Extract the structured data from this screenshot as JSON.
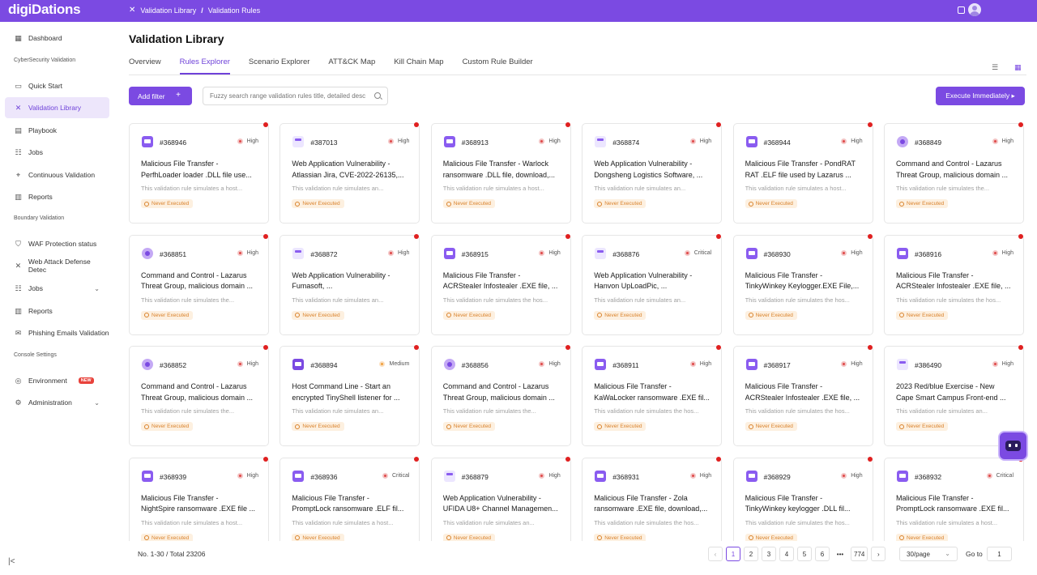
{
  "app": {
    "logo": "digiDations"
  },
  "breadcrumb": {
    "items": [
      "Validation Library",
      "Validation Rules"
    ],
    "separator": "/"
  },
  "sidebar": {
    "items": [
      {
        "label": "Dashboard",
        "icon": "grid-icon"
      },
      {
        "section": "CyberSecurity Validation"
      },
      {
        "label": "Quick Start",
        "icon": "monitor-icon"
      },
      {
        "label": "Validation Library",
        "icon": "cross-icon",
        "active": true
      },
      {
        "label": "Playbook",
        "icon": "book-icon"
      },
      {
        "label": "Jobs",
        "icon": "list-icon"
      },
      {
        "label": "Continuous Validation",
        "icon": "target-icon"
      },
      {
        "label": "Reports",
        "icon": "report-icon"
      },
      {
        "section": "Boundary Validation"
      },
      {
        "label": "WAF Protection status",
        "icon": "shield-icon"
      },
      {
        "label": "Web Attack Defense Detec",
        "icon": "cross-icon"
      },
      {
        "label": "Jobs",
        "icon": "list-icon",
        "expandable": true
      },
      {
        "label": "Reports",
        "icon": "report-icon"
      },
      {
        "label": "Phishing Emails Validation",
        "icon": "mail-icon"
      },
      {
        "section": "Console Settings"
      },
      {
        "label": "Environment",
        "icon": "env-icon",
        "badge": "NEW"
      },
      {
        "label": "Administration",
        "icon": "gear-icon",
        "expandable": true
      }
    ]
  },
  "page": {
    "title": "Validation Library"
  },
  "tabs": [
    {
      "label": "Overview"
    },
    {
      "label": "Rules Explorer",
      "active": true
    },
    {
      "label": "Scenario Explorer"
    },
    {
      "label": "ATT&CK Map"
    },
    {
      "label": "Kill Chain Map"
    },
    {
      "label": "Custom Rule Builder"
    }
  ],
  "toolbar": {
    "add_filter": "Add filter",
    "search_placeholder": "Fuzzy search range validation rules title, detailed desc",
    "execute": "Execute Immediately ▸"
  },
  "cards": [
    {
      "id": "#368946",
      "severity": "High",
      "icon": "file",
      "title1": "Malicious File Transfer -",
      "title2": "PerfhLoader loader .DLL file use...",
      "desc": "This validation rule simulates a host...",
      "status": "Never Executed"
    },
    {
      "id": "#387013",
      "severity": "High",
      "icon": "web",
      "title1": "Web Application Vulnerability -",
      "title2": "Atlassian Jira, CVE-2022-26135,...",
      "desc": "This validation rule simulates an...",
      "status": "Never Executed"
    },
    {
      "id": "#368913",
      "severity": "High",
      "icon": "file",
      "title1": "Malicious File Transfer - Warlock",
      "title2": "ransomware .DLL file, download,...",
      "desc": "This validation rule simulates a host...",
      "status": "Never Executed"
    },
    {
      "id": "#368874",
      "severity": "High",
      "icon": "web",
      "title1": "Web Application Vulnerability -",
      "title2": "Dongsheng Logistics Software, ...",
      "desc": "This validation rule simulates an...",
      "status": "Never Executed"
    },
    {
      "id": "#368944",
      "severity": "High",
      "icon": "file",
      "title1": "Malicious File Transfer - PondRAT",
      "title2": "RAT .ELF file used by Lazarus ...",
      "desc": "This validation rule simulates a host...",
      "status": "Never Executed"
    },
    {
      "id": "#368849",
      "severity": "High",
      "icon": "cc",
      "title1": "Command and Control - Lazarus",
      "title2": "Threat Group, malicious domain ...",
      "desc": "This validation rule simulates the...",
      "status": "Never Executed"
    },
    {
      "id": "#368851",
      "severity": "High",
      "icon": "cc",
      "title1": "Command and Control - Lazarus",
      "title2": "Threat Group, malicious domain ...",
      "desc": "This validation rule simulates the...",
      "status": "Never Executed"
    },
    {
      "id": "#368872",
      "severity": "High",
      "icon": "web",
      "title1": "Web Application Vulnerability -",
      "title2": "Fumasoft, ...",
      "desc": "This validation rule simulates an...",
      "status": "Never Executed"
    },
    {
      "id": "#368915",
      "severity": "High",
      "icon": "file",
      "title1": "Malicious File Transfer -",
      "title2": "ACRStealer Infostealer .EXE file, ...",
      "desc": "This validation rule simulates the hos...",
      "status": "Never Executed"
    },
    {
      "id": "#368876",
      "severity": "Critical",
      "icon": "web",
      "title1": "Web Application Vulnerability -",
      "title2": "Hanvon UpLoadPic, ...",
      "desc": "This validation rule simulates an...",
      "status": "Never Executed"
    },
    {
      "id": "#368930",
      "severity": "High",
      "icon": "file",
      "title1": "Malicious File Transfer -",
      "title2": "TinkyWinkey Keylogger.EXE File,...",
      "desc": "This validation rule simulates the hos...",
      "status": "Never Executed"
    },
    {
      "id": "#368916",
      "severity": "High",
      "icon": "file",
      "title1": "Malicious File Transfer -",
      "title2": "ACRStealer Infostealer .EXE file, ...",
      "desc": "This validation rule simulates the hos...",
      "status": "Never Executed"
    },
    {
      "id": "#368852",
      "severity": "High",
      "icon": "cc",
      "title1": "Command and Control - Lazarus",
      "title2": "Threat Group, malicious domain ...",
      "desc": "This validation rule simulates the...",
      "status": "Never Executed"
    },
    {
      "id": "#368894",
      "severity": "Medium",
      "icon": "host",
      "title1": "Host Command Line - Start an",
      "title2": "encrypted TinyShell listener for ...",
      "desc": "This validation rule simulates an...",
      "status": "Never Executed"
    },
    {
      "id": "#368856",
      "severity": "High",
      "icon": "cc",
      "title1": "Command and Control - Lazarus",
      "title2": "Threat Group, malicious domain ...",
      "desc": "This validation rule simulates the...",
      "status": "Never Executed"
    },
    {
      "id": "#368911",
      "severity": "High",
      "icon": "file",
      "title1": "Malicious File Transfer -",
      "title2": "KaWaLocker ransomware .EXE fil...",
      "desc": "This validation rule simulates the hos...",
      "status": "Never Executed"
    },
    {
      "id": "#368917",
      "severity": "High",
      "icon": "file",
      "title1": "Malicious File Transfer -",
      "title2": "ACRStealer Infostealer .EXE file, ...",
      "desc": "This validation rule simulates the hos...",
      "status": "Never Executed"
    },
    {
      "id": "#386490",
      "severity": "High",
      "icon": "web",
      "title1": "2023 Red/blue Exercise - New",
      "title2": "Cape Smart Campus Front-end ...",
      "desc": "This validation rule simulates an...",
      "status": "Never Executed"
    },
    {
      "id": "#368939",
      "severity": "High",
      "icon": "file",
      "title1": "Malicious File Transfer -",
      "title2": "NightSpire ransomware .EXE file ...",
      "desc": "This validation rule simulates a host...",
      "status": "Never Executed"
    },
    {
      "id": "#368936",
      "severity": "Critical",
      "icon": "file",
      "title1": "Malicious File Transfer -",
      "title2": "PromptLock ransomware .ELF fil...",
      "desc": "This validation rule simulates a host...",
      "status": "Never Executed"
    },
    {
      "id": "#368879",
      "severity": "High",
      "icon": "web",
      "title1": "Web Application Vulnerability -",
      "title2": "UFIDA U8+ Channel Managemen...",
      "desc": "This validation rule simulates an...",
      "status": "Never Executed"
    },
    {
      "id": "#368931",
      "severity": "High",
      "icon": "file",
      "title1": "Malicious File Transfer - Zola",
      "title2": "ransomware .EXE file, download,...",
      "desc": "This validation rule simulates the hos...",
      "status": "Never Executed"
    },
    {
      "id": "#368929",
      "severity": "High",
      "icon": "file",
      "title1": "Malicious File Transfer -",
      "title2": "TinkyWinkey keylogger .DLL fil...",
      "desc": "This validation rule simulates the hos...",
      "status": "Never Executed"
    },
    {
      "id": "#368932",
      "severity": "Critical",
      "icon": "file",
      "title1": "Malicious File Transfer -",
      "title2": "PromptLock ransomware .EXE fil...",
      "desc": "This validation rule simulates a host...",
      "status": "Never Executed"
    }
  ],
  "footer": {
    "total": "No. 1-30 / Total 23206",
    "pages": [
      "1",
      "2",
      "3",
      "4",
      "5",
      "6"
    ],
    "ellipsis": "•••",
    "last_page": "774",
    "current_page": "1",
    "page_size": "30/page",
    "goto_label": "Go to",
    "goto_value": "1"
  },
  "colors": {
    "accent": "#7b4ae2",
    "status": "#d9822b",
    "unread_dot": "#e02020"
  }
}
